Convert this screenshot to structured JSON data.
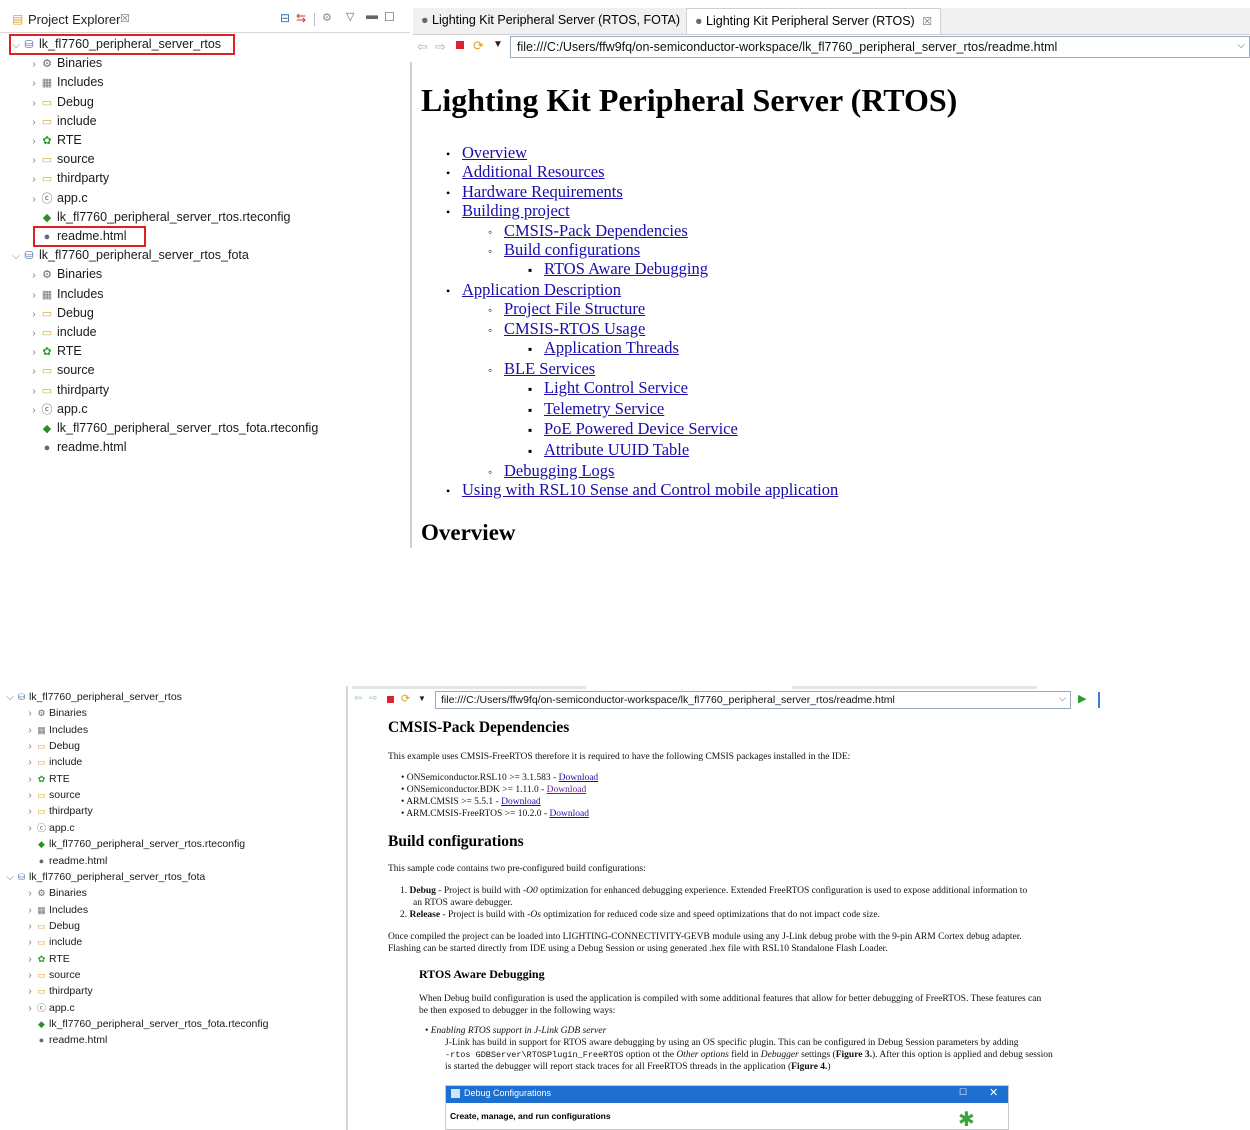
{
  "top": {
    "explorer": {
      "title": "Project Explorer",
      "close": "☒",
      "projects": [
        {
          "name": "lk_fl7760_peripheral_server_rtos",
          "items": [
            {
              "label": "Binaries",
              "icon": "binaries-icon"
            },
            {
              "label": "Includes",
              "icon": "includes-icon"
            },
            {
              "label": "Debug",
              "icon": "folder-icon"
            },
            {
              "label": "include",
              "icon": "folder-icon"
            },
            {
              "label": "RTE",
              "icon": "rte-icon"
            },
            {
              "label": "source",
              "icon": "folder-icon"
            },
            {
              "label": "thirdparty",
              "icon": "folder-icon"
            },
            {
              "label": "app.c",
              "icon": "c-file-icon"
            },
            {
              "label": "lk_fl7760_peripheral_server_rtos.rteconfig",
              "icon": "rteconfig-icon"
            },
            {
              "label": "readme.html",
              "icon": "html-file-icon"
            }
          ]
        },
        {
          "name": "lk_fl7760_peripheral_server_rtos_fota",
          "items": [
            {
              "label": "Binaries",
              "icon": "binaries-icon"
            },
            {
              "label": "Includes",
              "icon": "includes-icon"
            },
            {
              "label": "Debug",
              "icon": "folder-icon"
            },
            {
              "label": "include",
              "icon": "folder-icon"
            },
            {
              "label": "RTE",
              "icon": "rte-icon"
            },
            {
              "label": "source",
              "icon": "folder-icon"
            },
            {
              "label": "thirdparty",
              "icon": "folder-icon"
            },
            {
              "label": "app.c",
              "icon": "c-file-icon"
            },
            {
              "label": "lk_fl7760_peripheral_server_rtos_fota.rteconfig",
              "icon": "rteconfig-icon"
            },
            {
              "label": "readme.html",
              "icon": "html-file-icon"
            }
          ]
        }
      ]
    },
    "tabs": [
      {
        "label": "Lighting Kit Peripheral Server (RTOS, FOTA)",
        "active": false
      },
      {
        "label": "Lighting Kit Peripheral Server (RTOS)",
        "active": true,
        "close": "☒"
      }
    ],
    "url": "file:///C:/Users/ffw9fq/on-semiconductor-workspace/lk_fl7760_peripheral_server_rtos/readme.html",
    "page_title": "Lighting Kit Peripheral Server (RTOS)",
    "toc": [
      {
        "label": "Overview",
        "level": 1
      },
      {
        "label": "Additional Resources",
        "level": 1
      },
      {
        "label": "Hardware Requirements",
        "level": 1
      },
      {
        "label": "Building project",
        "level": 1
      },
      {
        "label": "CMSIS-Pack Dependencies",
        "level": 2
      },
      {
        "label": "Build configurations",
        "level": 2
      },
      {
        "label": "RTOS Aware Debugging",
        "level": 3
      },
      {
        "label": "Application Description",
        "level": 1
      },
      {
        "label": "Project File Structure",
        "level": 2
      },
      {
        "label": "CMSIS-RTOS Usage",
        "level": 2
      },
      {
        "label": "Application Threads",
        "level": 3
      },
      {
        "label": "BLE Services",
        "level": 2
      },
      {
        "label": "Light Control Service",
        "level": 3
      },
      {
        "label": "Telemetry Service",
        "level": 3
      },
      {
        "label": "PoE Powered Device Service",
        "level": 3
      },
      {
        "label": "Attribute UUID Table",
        "level": 3
      },
      {
        "label": "Debugging Logs",
        "level": 2
      },
      {
        "label": "Using with RSL10 Sense and Control mobile application",
        "level": 1
      }
    ],
    "overview_heading": "Overview"
  },
  "bottom": {
    "url": "file:///C:/Users/ffw9fq/on-semiconductor-workspace/lk_fl7760_peripheral_server_rtos/readme.html",
    "cmsis_heading": "CMSIS-Pack Dependencies",
    "cmsis_intro": "This example uses CMSIS-FreeRTOS therefore it is required to have the following CMSIS packages installed in the IDE:",
    "packages": [
      {
        "text": "ONSemiconductor.RSL10 >= 3.1.583 - ",
        "link": "Download"
      },
      {
        "text": "ONSemiconductor.BDK >= 1.11.0 - ",
        "link": "Download"
      },
      {
        "text": "ARM.CMSIS >= 5.5.1 - ",
        "link": "Download"
      },
      {
        "text": "ARM.CMSIS-FreeRTOS >= 10.2.0 - ",
        "link": "Download"
      }
    ],
    "build_heading": "Build configurations",
    "build_intro": "This sample code contains two pre-configured build configurations:",
    "build_items": [
      {
        "num": "1.",
        "bold": "Debug",
        "pre": " - Project is build with ",
        "em": "-O0",
        "post": " optimization for enhanced debugging experience. Extended FreeRTOS configuration is used to expose additional information to",
        "line2": "an RTOS aware debugger."
      },
      {
        "num": "2.",
        "bold": "Release",
        "pre": " - Project is build with ",
        "em": "-Os",
        "post": " optimization for reduced code size and speed optimizations that do not impact code size.",
        "line2": ""
      }
    ],
    "once_compiled_1": "Once compiled the project can be loaded into LIGHTING-CONNECTIVITY-GEVB module using any J-Link debug probe with the 9-pin ARM Cortex debug adapter.",
    "once_compiled_2": "Flashing can be started directly from IDE using a Debug Session or using generated .hex file with RSL10 Standalone Flash Loader.",
    "rtos_heading": "RTOS Aware Debugging",
    "rtos_para_1": "When Debug build configuration is used the application is compiled with some additional features that allow for better debugging of FreeRTOS. These features can",
    "rtos_para_2": "be then exposed to debugger in the following ways:",
    "bullet_title": "Enabling RTOS support in J-Link GDB server",
    "bullet_1": "J-Link has build in support for RTOS aware debugging by using an OS specific plugin. This can be configured in Debug Session parameters by adding",
    "bullet_2_code": "-rtos GDBServer\\RTOSPlugin_FreeRTOS",
    "bullet_2a": " option ot the ",
    "bullet_2_em1": "Other options",
    "bullet_2b": " field in ",
    "bullet_2_em2": "Debugger",
    "bullet_2c": " settings (",
    "bullet_2_fig": "Figure 3.",
    "bullet_2d": "). After this option is applied and debug session",
    "bullet_3": "is started the debugger will report stack traces for all FreeRTOS threads in the application (",
    "bullet_3_fig": "Figure 4.",
    "bullet_3_end": ")",
    "dialog_title": "Debug Configurations",
    "dialog_heading": "Create, manage, and run configurations"
  }
}
